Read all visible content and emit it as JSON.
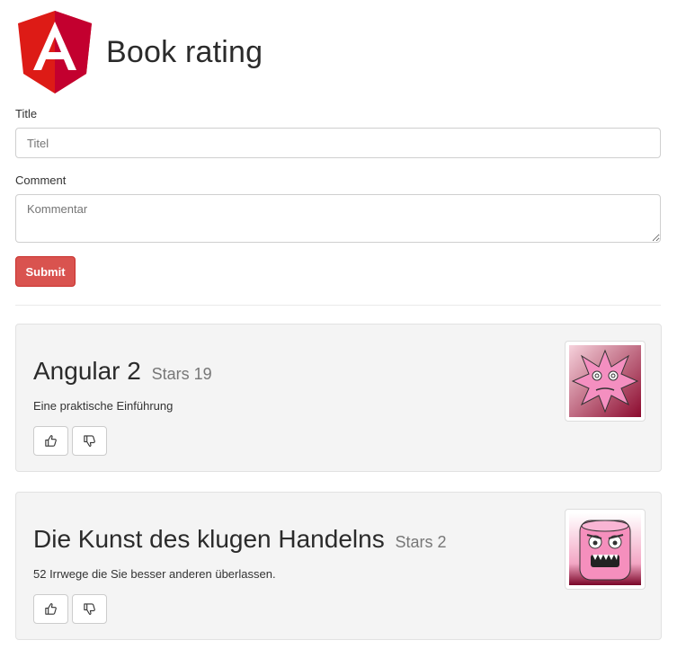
{
  "header": {
    "title": "Book rating",
    "logo_icon": "angular-logo-icon"
  },
  "form": {
    "title_label": "Title",
    "title_placeholder": "Titel",
    "comment_label": "Comment",
    "comment_placeholder": "Kommentar",
    "submit_label": "Submit"
  },
  "books": [
    {
      "title": "Angular 2",
      "stars": "Stars 19",
      "description": "Eine praktische Einführung",
      "avatar_icon": "pink-star-monster-avatar"
    },
    {
      "title": "Die Kunst des klugen Handelns",
      "stars": "Stars 2",
      "description": "52 Irrwege die Sie besser anderen überlassen.",
      "avatar_icon": "pink-block-monster-avatar"
    }
  ],
  "colors": {
    "accent": "#d9534f",
    "logo_red": "#dd1b16",
    "card_bg": "#f4f4f4"
  }
}
